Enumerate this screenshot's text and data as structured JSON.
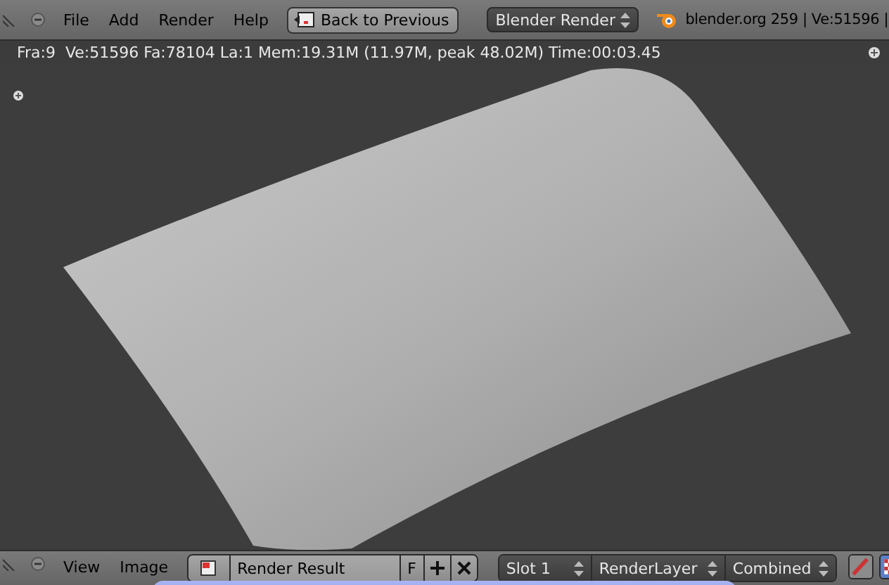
{
  "top_header": {
    "menus": [
      "File",
      "Add",
      "Render",
      "Help"
    ],
    "back_button": "Back to Previous",
    "engine": "Blender Render",
    "info": "blender.org 259 | Ve:51596 |"
  },
  "render_info": "Fra:9  Ve:51596 Fa:78104 La:1 Mem:19.31M (11.97M, peak 48.02M) Time:00:03.45",
  "bottom_header": {
    "menus": [
      "View",
      "Image"
    ],
    "image_name": "Render Result",
    "fake_user": "F",
    "slot": "Slot 1",
    "layer": "RenderLayer",
    "pass": "Combined"
  }
}
